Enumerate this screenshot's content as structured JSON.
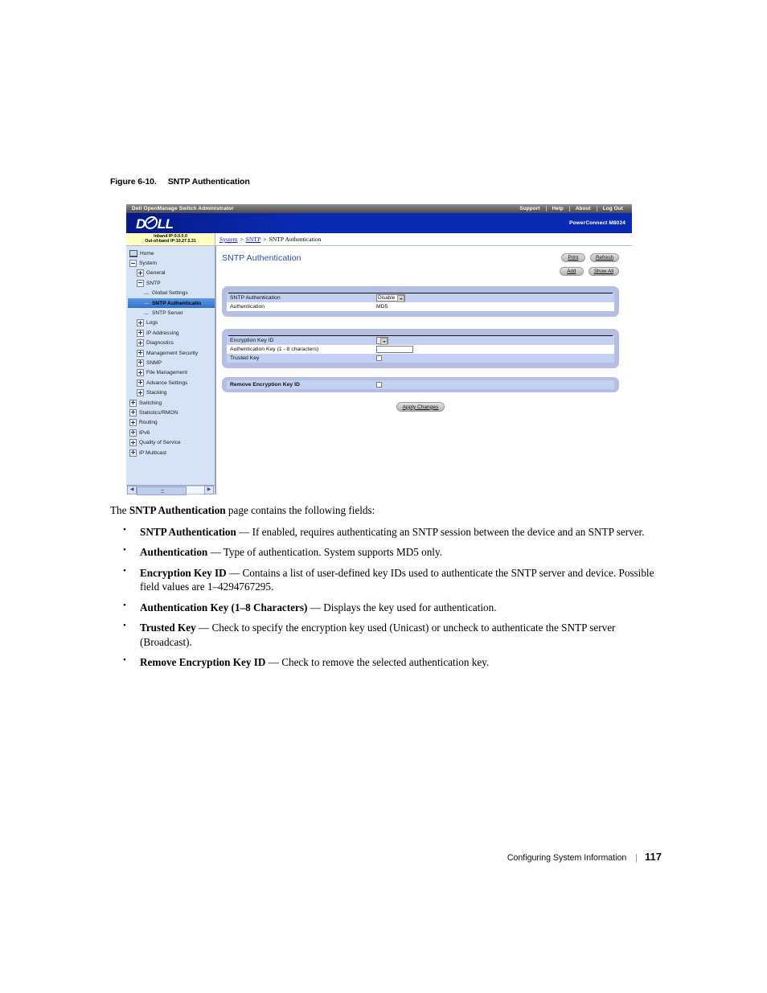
{
  "figure": {
    "number": "Figure 6-10.",
    "title": "SNTP Authentication"
  },
  "screenshot": {
    "titlebar": {
      "app_title": "Dell OpenManage Switch Administrator",
      "links": [
        "Support",
        "Help",
        "About",
        "Log Out"
      ]
    },
    "brand": {
      "logo_pre": "D",
      "logo_post": "LL",
      "model": "PowerConnect M8024"
    },
    "status": {
      "inband": "Inband IP:0.0.0.0",
      "outofband": "Out-of-band IP:10.27.5.31"
    },
    "breadcrumb": {
      "items": [
        "System",
        "SNTP",
        "SNTP Authentication"
      ],
      "separator": ">"
    },
    "sidebar": {
      "items": [
        {
          "label": "Home",
          "level": 0,
          "marker": "home",
          "selected": false
        },
        {
          "label": "System",
          "level": 0,
          "marker": "minus",
          "selected": false
        },
        {
          "label": "General",
          "level": 1,
          "marker": "plus",
          "selected": false
        },
        {
          "label": "SNTP",
          "level": 1,
          "marker": "minus",
          "selected": false
        },
        {
          "label": "Global Settings",
          "level": 2,
          "marker": "leaf",
          "selected": false
        },
        {
          "label": "SNTP Authenticatio",
          "level": 2,
          "marker": "leaf",
          "selected": true
        },
        {
          "label": "SNTP Server",
          "level": 2,
          "marker": "leaf",
          "selected": false
        },
        {
          "label": "Logs",
          "level": 1,
          "marker": "plus",
          "selected": false
        },
        {
          "label": "IP Addressing",
          "level": 1,
          "marker": "plus",
          "selected": false
        },
        {
          "label": "Diagnostics",
          "level": 1,
          "marker": "plus",
          "selected": false
        },
        {
          "label": "Management Security",
          "level": 1,
          "marker": "plus",
          "selected": false
        },
        {
          "label": "SNMP",
          "level": 1,
          "marker": "plus",
          "selected": false
        },
        {
          "label": "File Management",
          "level": 1,
          "marker": "plus",
          "selected": false
        },
        {
          "label": "Advance Settings",
          "level": 1,
          "marker": "plus",
          "selected": false
        },
        {
          "label": "Stacking",
          "level": 1,
          "marker": "plus",
          "selected": false
        },
        {
          "label": "Switching",
          "level": 0,
          "marker": "plus",
          "selected": false
        },
        {
          "label": "Statistics/RMON",
          "level": 0,
          "marker": "plus",
          "selected": false
        },
        {
          "label": "Routing",
          "level": 0,
          "marker": "plus",
          "selected": false
        },
        {
          "label": "IPv6",
          "level": 0,
          "marker": "plus",
          "selected": false
        },
        {
          "label": "Quality of Service",
          "level": 0,
          "marker": "plus",
          "selected": false
        },
        {
          "label": "IP Multicast",
          "level": 0,
          "marker": "plus",
          "selected": false
        }
      ]
    },
    "content": {
      "page_title": "SNTP Authentication",
      "buttons": {
        "print": "Print",
        "refresh": "Refresh",
        "add": "Add",
        "show_all": "Show All",
        "apply": "Apply Changes"
      },
      "panel1": {
        "rows": [
          {
            "label": "SNTP Authentication",
            "control": "select",
            "value": "Disable"
          },
          {
            "label": "Authentication",
            "control": "text",
            "value": "MD5"
          }
        ]
      },
      "panel2": {
        "rows": [
          {
            "label": "Encryption Key ID",
            "control": "select-empty",
            "value": ""
          },
          {
            "label": "Authentication Key (1 - 8 characters)",
            "control": "input",
            "value": ""
          },
          {
            "label": "Trusted Key",
            "control": "checkbox",
            "value": ""
          }
        ]
      },
      "panel3": {
        "rows": [
          {
            "label": "Remove Encryption Key ID",
            "control": "checkbox",
            "value": ""
          }
        ]
      }
    }
  },
  "prose": {
    "lead_pre": "The ",
    "lead_bold": "SNTP Authentication",
    "lead_post": " page contains the following fields:",
    "bullets": [
      {
        "term": "SNTP Authentication",
        "dash": " — ",
        "desc": "If enabled, requires authenticating an SNTP session between the device and an SNTP server."
      },
      {
        "term": "Authentication",
        "dash": " — ",
        "desc": "Type of authentication. System supports MD5 only."
      },
      {
        "term": "Encryption Key ID",
        "dash": " — ",
        "desc": "Contains a list of user-defined key IDs used to authenticate the SNTP server and device. Possible field values are 1–4294767295."
      },
      {
        "term": "Authentication Key (1–8 Characters)",
        "dash": " — ",
        "desc": "Displays the key used for authentication."
      },
      {
        "term": "Trusted Key",
        "dash": " — ",
        "desc": "Check to specify the encryption key used (Unicast) or uncheck to authenticate the SNTP server (Broadcast)."
      },
      {
        "term": "Remove Encryption Key ID",
        "dash": " — ",
        "desc": "Check to remove the selected authentication key."
      }
    ]
  },
  "footer": {
    "section": "Configuring System Information",
    "separator": "|",
    "page_number": "117"
  },
  "colors": {
    "brand_blue": "#0b2ab4",
    "title_link": "#2a4ba8",
    "panel_bg": "#b6bee2",
    "row_alt": "#c3d0ef",
    "status_yellow": "#ffffc2",
    "sidebar_bg": "#d6e2f5",
    "selected_row": "#2f72cf",
    "crumb_link": "#1414d2"
  }
}
